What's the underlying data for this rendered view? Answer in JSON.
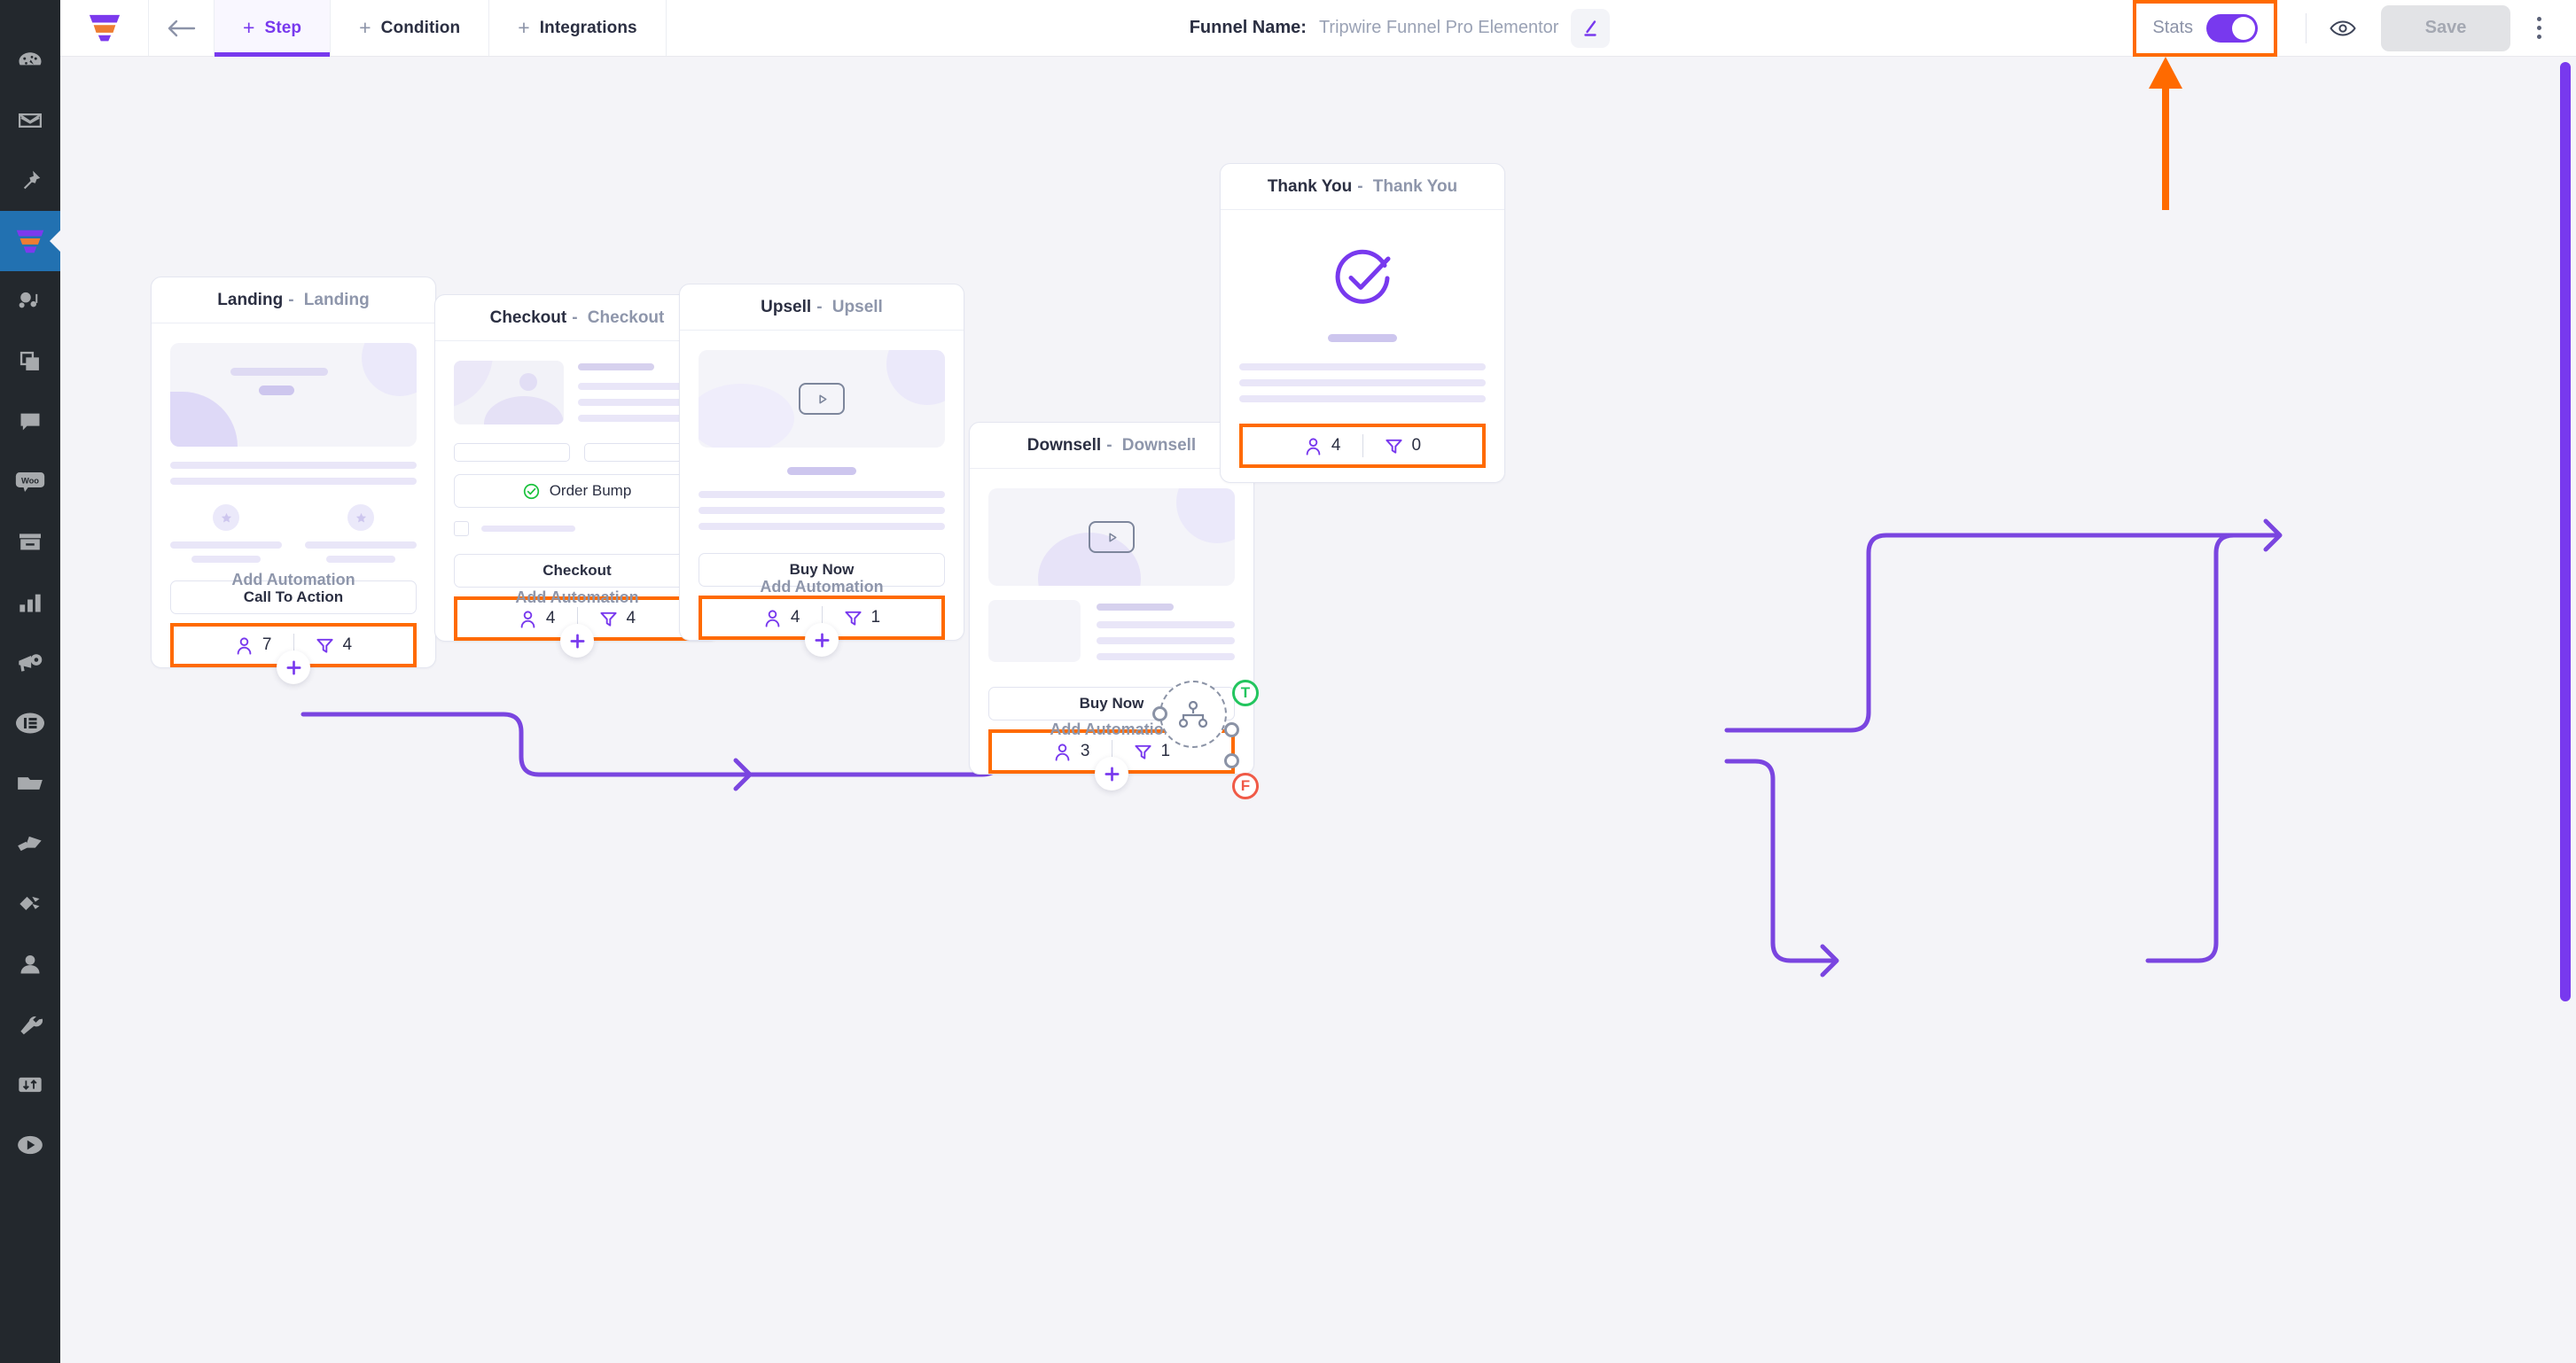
{
  "app": {
    "background_color": "#f4f4f8",
    "accent_color": "#7839ee",
    "highlight_color": "#ff6a00"
  },
  "wp_rail": {
    "items": [
      {
        "icon": "dashboard-icon",
        "label": "Dashboard"
      },
      {
        "icon": "mail-icon",
        "label": "Mail"
      },
      {
        "icon": "pin-icon",
        "label": "Pinned"
      },
      {
        "icon": "funnel-icon",
        "label": "Funnels",
        "active": true
      },
      {
        "icon": "media-icon",
        "label": "Media"
      },
      {
        "icon": "pages-icon",
        "label": "Pages"
      },
      {
        "icon": "comments-icon",
        "label": "Comments"
      },
      {
        "icon": "woo-icon",
        "label": "WooCommerce"
      },
      {
        "icon": "archive-icon",
        "label": "Products"
      },
      {
        "icon": "analytics-icon",
        "label": "Analytics"
      },
      {
        "icon": "marketing-icon",
        "label": "Marketing"
      },
      {
        "icon": "elementor-icon",
        "label": "Elementor"
      },
      {
        "icon": "folder-icon",
        "label": "Templates"
      },
      {
        "icon": "brush-icon",
        "label": "Appearance"
      },
      {
        "icon": "plug-icon",
        "label": "Plugins"
      },
      {
        "icon": "user-icon",
        "label": "Users"
      },
      {
        "icon": "wrench-icon",
        "label": "Tools"
      },
      {
        "icon": "settings-sliders-icon",
        "label": "Settings"
      },
      {
        "icon": "play-icon",
        "label": "Video"
      }
    ]
  },
  "topbar": {
    "logo": "funnel-logo-icon",
    "back": "back-arrow-icon",
    "tabs": [
      {
        "id": "step",
        "label": "Step",
        "active": true
      },
      {
        "id": "condition",
        "label": "Condition",
        "active": false
      },
      {
        "id": "integrations",
        "label": "Integrations",
        "active": false
      }
    ],
    "funnel_name_label": "Funnel Name:",
    "funnel_name_value": "Tripwire Funnel Pro Elementor",
    "edit_icon": "pencil-icon",
    "stats_label": "Stats",
    "stats_toggle_on": true,
    "preview_icon": "eye-icon",
    "save_label": "Save",
    "save_disabled": true,
    "more_icon": "kebab-menu-icon"
  },
  "canvas": {
    "add_automation_label": "Add Automation",
    "add_step_icon": "plus-icon",
    "condition_node": {
      "icon": "sitemap-icon",
      "true_label": "T",
      "false_label": "F",
      "true_color": "#22c55e",
      "false_color": "#f05a47"
    },
    "nodes": [
      {
        "id": "landing",
        "title": "Landing",
        "subtitle": "Landing",
        "cta_label": "Call To Action",
        "stats": {
          "contacts_icon": "user-icon",
          "contacts": "7",
          "conversions_icon": "funnel-icon",
          "conversions": "4"
        },
        "add_automation": "Add Automation"
      },
      {
        "id": "checkout",
        "title": "Checkout",
        "subtitle": "Checkout",
        "order_bump_label": "Order Bump",
        "order_bump_icon": "check-circle-icon",
        "cta_label": "Checkout",
        "stats": {
          "contacts_icon": "user-icon",
          "contacts": "4",
          "conversions_icon": "funnel-icon",
          "conversions": "4"
        },
        "add_automation": "Add Automation"
      },
      {
        "id": "upsell",
        "title": "Upsell",
        "subtitle": "Upsell",
        "media_icon": "video-icon",
        "cta_label": "Buy Now",
        "stats": {
          "contacts_icon": "user-icon",
          "contacts": "4",
          "conversions_icon": "funnel-icon",
          "conversions": "1"
        },
        "add_automation": "Add Automation"
      },
      {
        "id": "downsell",
        "title": "Downsell",
        "subtitle": "Downsell",
        "media_icon": "video-icon",
        "cta_label": "Buy Now",
        "stats": {
          "contacts_icon": "user-icon",
          "contacts": "3",
          "conversions_icon": "funnel-icon",
          "conversions": "1"
        },
        "add_automation": "Add Automation"
      },
      {
        "id": "thankyou",
        "title": "Thank You",
        "subtitle": "Thank You",
        "media_icon": "check-circle-big-icon",
        "stats": {
          "contacts_icon": "user-icon",
          "contacts": "4",
          "conversions_icon": "funnel-icon",
          "conversions": "0"
        }
      }
    ]
  },
  "annotations": {
    "stats_callout_arrow": "orange-up-arrow"
  }
}
